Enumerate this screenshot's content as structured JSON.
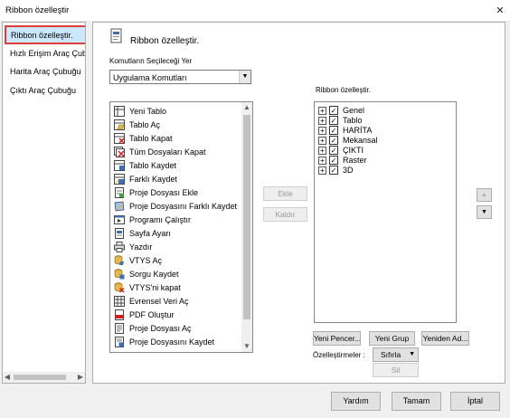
{
  "window": {
    "title": "Ribbon özelleştir",
    "close_glyph": "✕"
  },
  "nav": {
    "items": [
      {
        "label": "Ribbon özelleştir.",
        "selected": true
      },
      {
        "label": "Hızlı Erişim Araç Çubuğu",
        "selected": false
      },
      {
        "label": "Harita Araç Çubuğu",
        "selected": false
      },
      {
        "label": "Çıktı Araç Çubuğu",
        "selected": false
      }
    ]
  },
  "header": {
    "title": "Ribbon özelleştir.",
    "icon": "ribbon-customize-icon"
  },
  "commands_source": {
    "label": "Komutların Seçileceği Yer",
    "selected": "Uygulama Komutları"
  },
  "commands": [
    {
      "label": "Yeni Tablo",
      "icon": "new-table-icon"
    },
    {
      "label": "Tablo Aç",
      "icon": "open-table-icon"
    },
    {
      "label": "Tablo Kapat",
      "icon": "close-table-icon"
    },
    {
      "label": "Tüm Dosyaları  Kapat",
      "icon": "close-all-files-icon"
    },
    {
      "label": "Tablo Kaydet",
      "icon": "save-table-icon"
    },
    {
      "label": "Farklı Kaydet",
      "icon": "save-as-icon"
    },
    {
      "label": "Proje Dosyası Ekle",
      "icon": "add-project-file-icon"
    },
    {
      "label": "Proje Dosyasını Farklı Kaydet",
      "icon": "save-project-as-icon"
    },
    {
      "label": "Programı Çalıştır",
      "icon": "run-program-icon"
    },
    {
      "label": "Sayfa Ayarı",
      "icon": "page-setup-icon"
    },
    {
      "label": "Yazdır",
      "icon": "print-icon"
    },
    {
      "label": "VTYS Aç",
      "icon": "open-dbms-icon"
    },
    {
      "label": "Sorgu Kaydet",
      "icon": "save-query-icon"
    },
    {
      "label": "VTYS'ni kapat",
      "icon": "close-dbms-icon"
    },
    {
      "label": "Evrensel Veri Aç",
      "icon": "open-universal-data-icon"
    },
    {
      "label": "PDF Oluştur",
      "icon": "create-pdf-icon"
    },
    {
      "label": "Proje Dosyası Aç",
      "icon": "open-project-file-icon"
    },
    {
      "label": "Proje Dosyasını Kaydet",
      "icon": "save-project-file-icon"
    }
  ],
  "actions": {
    "add": "Ekle",
    "remove": "Kaldır"
  },
  "ribbon": {
    "label": "Ribbon özelleştir.",
    "tabs": [
      {
        "label": "Genel",
        "checked": true
      },
      {
        "label": "Tablo",
        "checked": true
      },
      {
        "label": "HARİTA",
        "checked": true
      },
      {
        "label": "Mekansal",
        "checked": true
      },
      {
        "label": "ÇIKTI",
        "checked": true
      },
      {
        "label": "Raster",
        "checked": true
      },
      {
        "label": "3D",
        "checked": true
      }
    ]
  },
  "ribbon_buttons": {
    "new_window": "Yeni Pencer...",
    "new_group": "Yeni Grup",
    "rename": "Yeniden Ad..."
  },
  "customizations": {
    "label": "Özelleştirmeler :",
    "reset": "Sıfırla",
    "delete": "Sil"
  },
  "footer": {
    "help": "Yardım",
    "ok": "Tamam",
    "cancel": "İptal"
  },
  "colors": {
    "selection": "#cce8ff",
    "highlight_border": "#e03c3c"
  }
}
